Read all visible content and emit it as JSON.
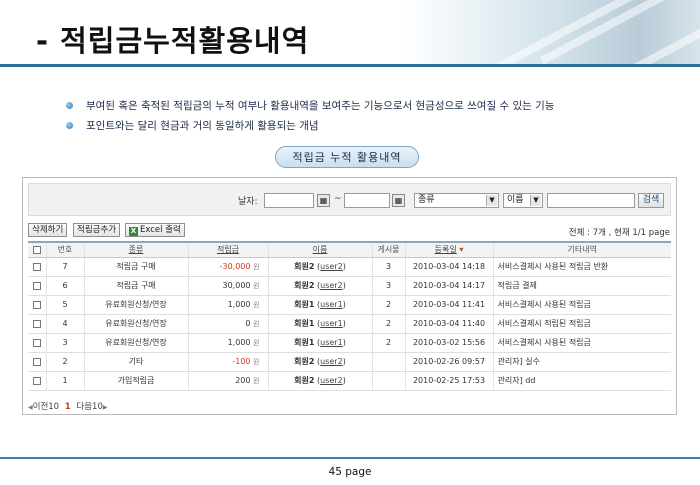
{
  "header": {
    "title": "- 적립금누적활용내역"
  },
  "bullets": [
    "부여된 혹은 축적된 적립금의 누적 여부나 활용내역을 보여주는 기능으로서 현금성으로 쓰여질 수 있는 기능",
    "포인트와는 달리 현금과 거의 동일하게 활용되는 개념"
  ],
  "section_pill": "적립금 누적 활용내역",
  "search": {
    "date_label": "날자:",
    "date_separator": "~",
    "category_select": "종류",
    "field_select": "이름",
    "search_button": "검색"
  },
  "toolbar": {
    "delete_button": "삭제하기",
    "add_button": "적립금추가",
    "excel_button": "Excel 출력",
    "excel_icon_glyph": "X",
    "total_text": "전체 : 7개 , 현재 1/1 page"
  },
  "columns": [
    "번호",
    "종류",
    "적립금",
    "이름",
    "게시물",
    "등록일",
    "기타내역"
  ],
  "sort_indicator": "▾",
  "currency_unit": "원",
  "rows": [
    {
      "no": "7",
      "type": "적립금 구매",
      "amount": "-30,000",
      "negative": true,
      "name": "회원2",
      "id": "user2",
      "posts": "3",
      "date": "2010-03-04 14:18",
      "note": "서비스결제시 사용된 적립금 반환"
    },
    {
      "no": "6",
      "type": "적립금 구매",
      "amount": "30,000",
      "negative": false,
      "name": "회원2",
      "id": "user2",
      "posts": "3",
      "date": "2010-03-04 14:17",
      "note": "적립금 결제"
    },
    {
      "no": "5",
      "type": "유료회원신청/연장",
      "amount": "1,000",
      "negative": false,
      "name": "회원1",
      "id": "user1",
      "posts": "2",
      "date": "2010-03-04 11:41",
      "note": "서비스결제시 사용된 적립금"
    },
    {
      "no": "4",
      "type": "유료회원신청/연장",
      "amount": "0",
      "negative": false,
      "name": "회원1",
      "id": "user1",
      "posts": "2",
      "date": "2010-03-04 11:40",
      "note": "서비스결제시 적립된 적립금"
    },
    {
      "no": "3",
      "type": "유료회원신청/연장",
      "amount": "1,000",
      "negative": false,
      "name": "회원1",
      "id": "user1",
      "posts": "2",
      "date": "2010-03-02 15:56",
      "note": "서비스결제시 사용된 적립금"
    },
    {
      "no": "2",
      "type": "기타",
      "amount": "-100",
      "negative": true,
      "name": "회원2",
      "id": "user2",
      "posts": "",
      "date": "2010-02-26 09:57",
      "note": "관리자] 실수"
    },
    {
      "no": "1",
      "type": "가입적립금",
      "amount": "200",
      "negative": false,
      "name": "회원2",
      "id": "user2",
      "posts": "",
      "date": "2010-02-25 17:53",
      "note": "관리자] dd"
    }
  ],
  "pager": {
    "prev": "이전10",
    "current": "1",
    "next": "다음10",
    "prev_arrow": "◀",
    "next_arrow": "▶"
  },
  "footer": {
    "page_label": "45 page"
  },
  "colors": {
    "accent_blue": "#2f6f9c",
    "negative_red": "#d23a1a"
  }
}
